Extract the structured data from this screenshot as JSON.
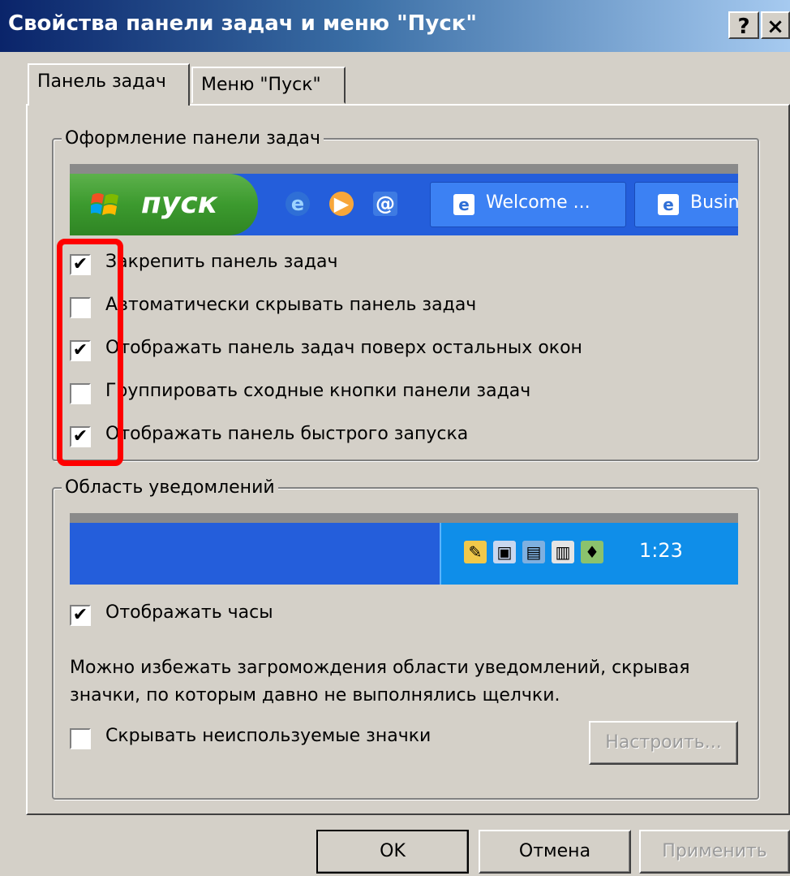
{
  "window": {
    "title": "Свойства панели задач и меню \"Пуск\"",
    "help_label": "?",
    "close_label": "×"
  },
  "tabs": [
    {
      "label": "Панель задач",
      "selected": true
    },
    {
      "label": "Меню \"Пуск\"",
      "selected": false
    }
  ],
  "taskbar_group": {
    "legend": "Оформление панели задач",
    "preview": {
      "start_label": "пуск",
      "tasks": [
        "Welcome ...",
        "Busin"
      ]
    },
    "options": [
      {
        "label": "Закрепить панель задач",
        "checked": true
      },
      {
        "label": "Автоматически скрывать панель задач",
        "checked": false
      },
      {
        "label": "Отображать панель задач поверх остальных окон",
        "checked": true
      },
      {
        "label": "Группировать сходные кнопки панели задач",
        "checked": false
      },
      {
        "label": "Отображать панель быстрого запуска",
        "checked": true
      }
    ]
  },
  "notify_group": {
    "legend": "Область уведомлений",
    "clock_time": "1:23",
    "show_clock": {
      "label": "Отображать часы",
      "checked": true
    },
    "description": "Можно избежать загромождения области уведомлений, скрывая значки, по которым давно не выполнялись щелчки.",
    "hide_inactive": {
      "label": "Скрывать неиспользуемые значки",
      "checked": false
    },
    "customize_label": "Настроить..."
  },
  "buttons": {
    "ok": "OK",
    "cancel": "Отмена",
    "apply": "Применить"
  },
  "check_mark": "✔",
  "colors": {
    "dialog_bg": "#d4d0c8",
    "taskbar_blue": "#245edb",
    "start_green": "#3c9a2e",
    "highlight_red": "#ff0000"
  }
}
